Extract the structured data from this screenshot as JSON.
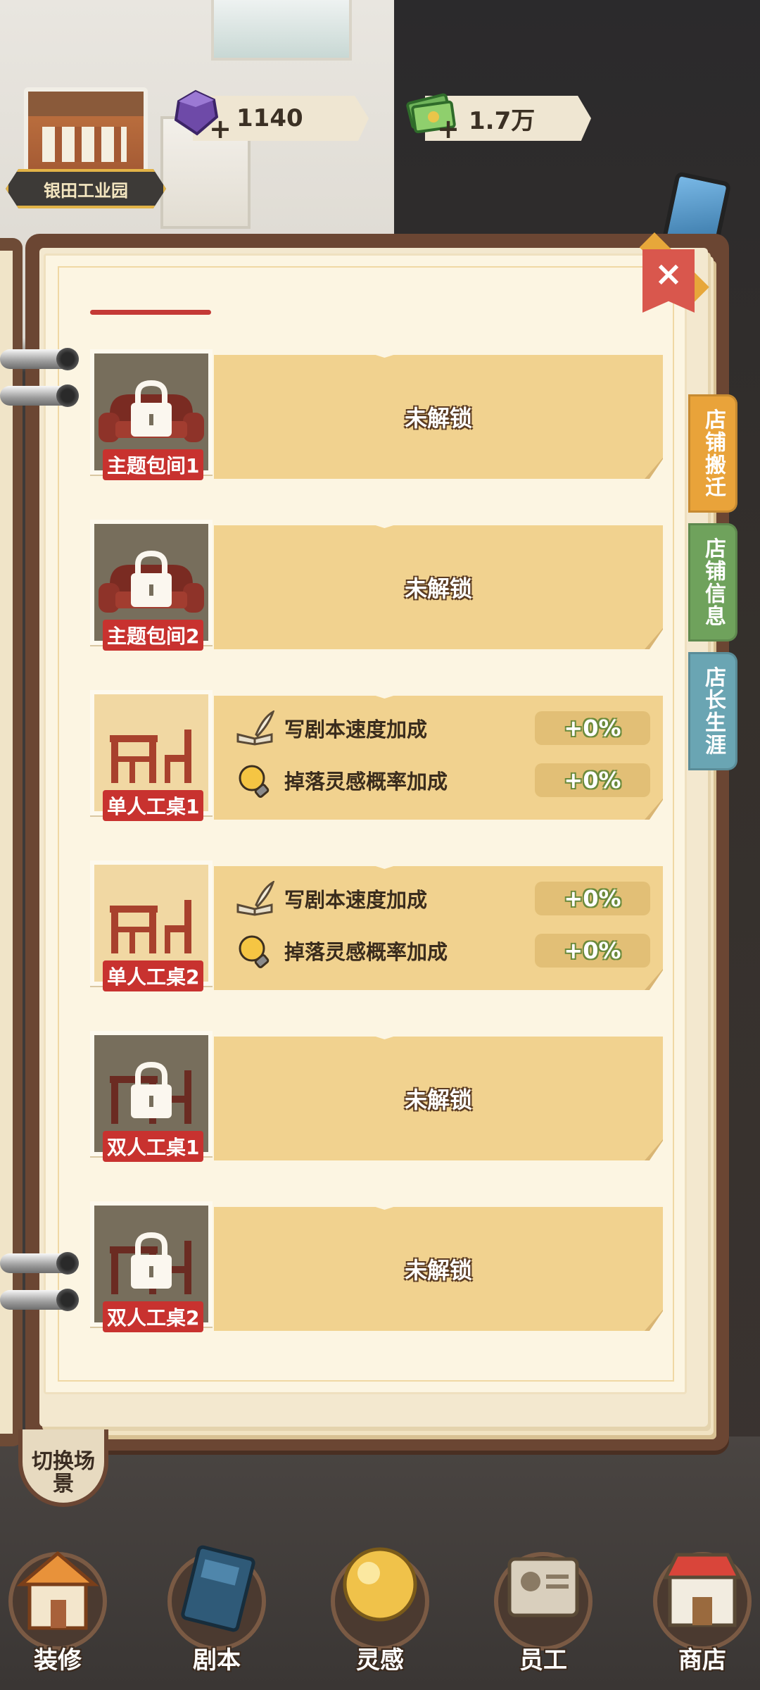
{
  "top_bar": {
    "location_name": "银田工业园",
    "gems": "1140",
    "cash": "1.7万"
  },
  "close_label": "×",
  "side_tabs": [
    {
      "label": "店铺搬迁",
      "color": "#e9a33a"
    },
    {
      "label": "店铺信息",
      "color": "#6fa25c"
    },
    {
      "label": "店长生涯",
      "color": "#6aa5b3"
    }
  ],
  "rows": [
    {
      "name": "主题包间1",
      "state": "locked",
      "status": "未解锁",
      "icon": "sofa-icon"
    },
    {
      "name": "主题包间2",
      "state": "locked",
      "status": "未解锁",
      "icon": "sofa-icon"
    },
    {
      "name": "单人工桌1",
      "state": "unlocked",
      "icon": "desk-icon",
      "stats": [
        {
          "label": "写剧本速度加成",
          "value": "+0%",
          "icon": "book-quill-icon"
        },
        {
          "label": "掉落灵感概率加成",
          "value": "+0%",
          "icon": "lightbulb-icon"
        }
      ]
    },
    {
      "name": "单人工桌2",
      "state": "unlocked",
      "icon": "desk-icon",
      "stats": [
        {
          "label": "写剧本速度加成",
          "value": "+0%",
          "icon": "book-quill-icon"
        },
        {
          "label": "掉落灵感概率加成",
          "value": "+0%",
          "icon": "lightbulb-icon"
        }
      ]
    },
    {
      "name": "双人工桌1",
      "state": "locked",
      "status": "未解锁",
      "icon": "desk-icon"
    },
    {
      "name": "双人工桌2",
      "state": "locked",
      "status": "未解锁",
      "icon": "desk-icon"
    }
  ],
  "switch_scene_label": "切换场景",
  "bottom_nav": [
    {
      "label": "装修",
      "icon": "house-icon"
    },
    {
      "label": "剧本",
      "icon": "script-book-icon"
    },
    {
      "label": "灵感",
      "icon": "inspiration-orb-icon"
    },
    {
      "label": "员工",
      "icon": "staff-card-icon"
    },
    {
      "label": "商店",
      "icon": "shop-icon"
    }
  ],
  "colors": {
    "locked_thumb": "#776e5c",
    "banner": "#f1d28f",
    "label_red": "#c8322f",
    "close_red": "#d9574d"
  }
}
